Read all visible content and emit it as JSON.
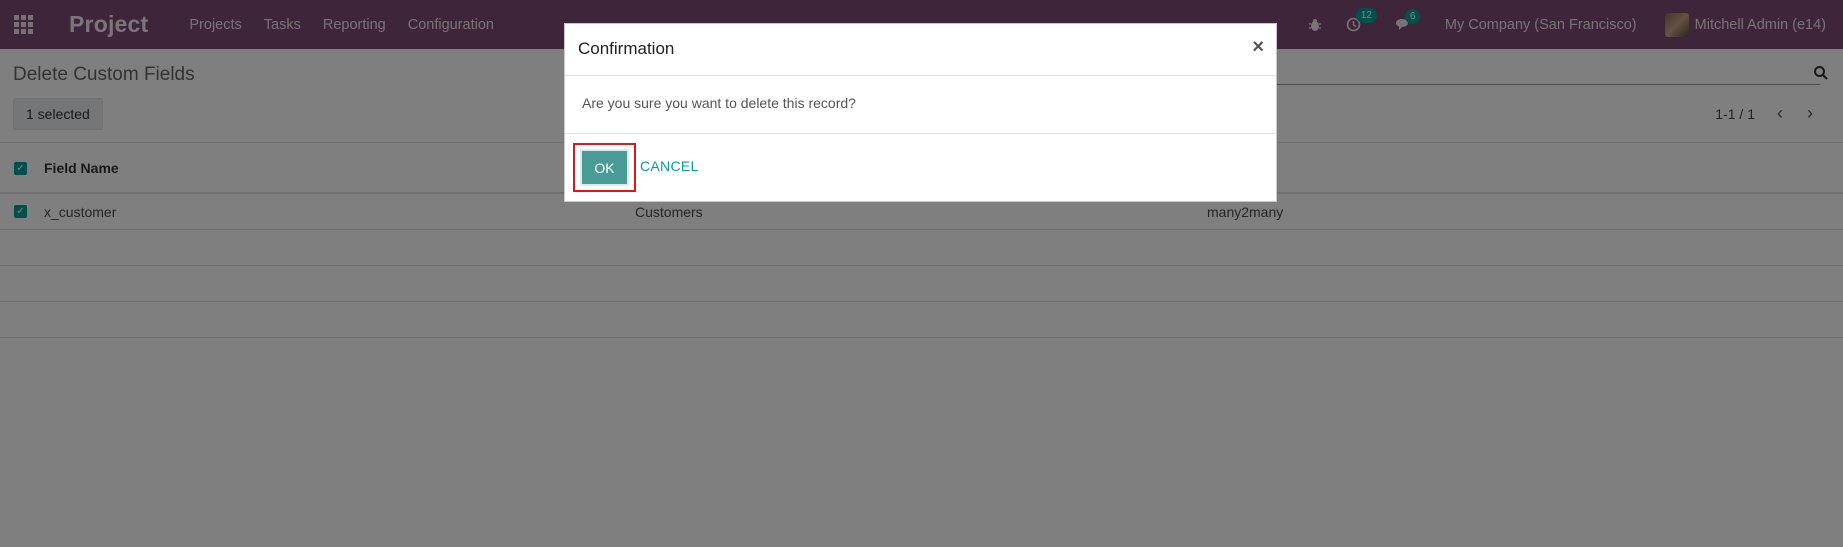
{
  "navbar": {
    "app_name": "Project",
    "menu": [
      "Projects",
      "Tasks",
      "Reporting",
      "Configuration"
    ],
    "activity_count": "12",
    "messages_count": "6",
    "company": "My Company (San Francisco)",
    "user": "Mitchell Admin (e14)"
  },
  "control_panel": {
    "title": "Delete Custom Fields",
    "selected_label": "1 selected",
    "pager": "1-1 / 1"
  },
  "list": {
    "header": {
      "field_name": "Field Name"
    },
    "rows": [
      {
        "name": "x_customer",
        "model": "Customers",
        "type": "many2many"
      }
    ]
  },
  "modal": {
    "title": "Confirmation",
    "close": "×",
    "message": "Are you sure you want to delete this record?",
    "ok_label": "OK",
    "cancel_label": "CANCEL"
  },
  "colors": {
    "navbar": "#7c4b73",
    "accent": "#00a09d",
    "highlight": "#e0141e"
  }
}
